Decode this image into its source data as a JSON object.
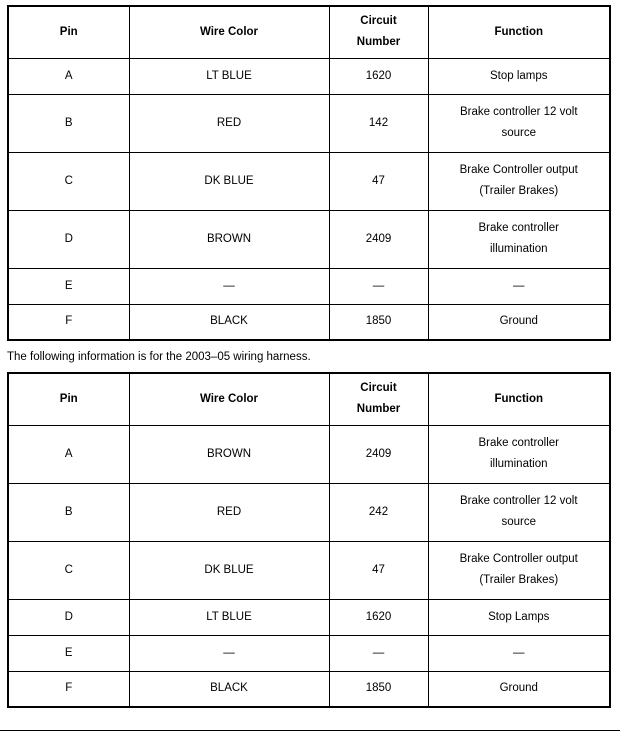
{
  "document": {
    "type": "wiring-harness-pin-reference",
    "bottom_rule": true,
    "note_between_tables": "The following information is for the 2003–05 wiring harness."
  },
  "columns": {
    "pin": "Pin",
    "wire_color": "Wire Color",
    "circuit_number_line1": "Circuit",
    "circuit_number_line2": "Number",
    "function": "Function"
  },
  "table1": {
    "rows": [
      {
        "pin": "A",
        "wire_color": "LT BLUE",
        "circuit_number": "1620",
        "function_line1": "Stop lamps",
        "function_line2": ""
      },
      {
        "pin": "B",
        "wire_color": "RED",
        "circuit_number": "142",
        "function_line1": "Brake controller 12 volt",
        "function_line2": "source"
      },
      {
        "pin": "C",
        "wire_color": "DK BLUE",
        "circuit_number": "47",
        "function_line1": "Brake Controller output",
        "function_line2": "(Trailer Brakes)"
      },
      {
        "pin": "D",
        "wire_color": "BROWN",
        "circuit_number": "2409",
        "function_line1": "Brake controller",
        "function_line2": "illumination"
      },
      {
        "pin": "E",
        "wire_color": "—",
        "circuit_number": "—",
        "function_line1": "—",
        "function_line2": ""
      },
      {
        "pin": "F",
        "wire_color": "BLACK",
        "circuit_number": "1850",
        "function_line1": "Ground",
        "function_line2": ""
      }
    ]
  },
  "table2": {
    "rows": [
      {
        "pin": "A",
        "wire_color": "BROWN",
        "circuit_number": "2409",
        "function_line1": "Brake controller",
        "function_line2": "illumination"
      },
      {
        "pin": "B",
        "wire_color": "RED",
        "circuit_number": "242",
        "function_line1": "Brake controller 12 volt",
        "function_line2": "source"
      },
      {
        "pin": "C",
        "wire_color": "DK BLUE",
        "circuit_number": "47",
        "function_line1": "Brake Controller output",
        "function_line2": "(Trailer Brakes)"
      },
      {
        "pin": "D",
        "wire_color": "LT BLUE",
        "circuit_number": "1620",
        "function_line1": "Stop Lamps",
        "function_line2": ""
      },
      {
        "pin": "E",
        "wire_color": "—",
        "circuit_number": "—",
        "function_line1": "—",
        "function_line2": ""
      },
      {
        "pin": "F",
        "wire_color": "BLACK",
        "circuit_number": "1850",
        "function_line1": "Ground",
        "function_line2": ""
      }
    ]
  },
  "colors": {
    "border": "#000000",
    "text": "#000000",
    "background": "#ffffff"
  }
}
